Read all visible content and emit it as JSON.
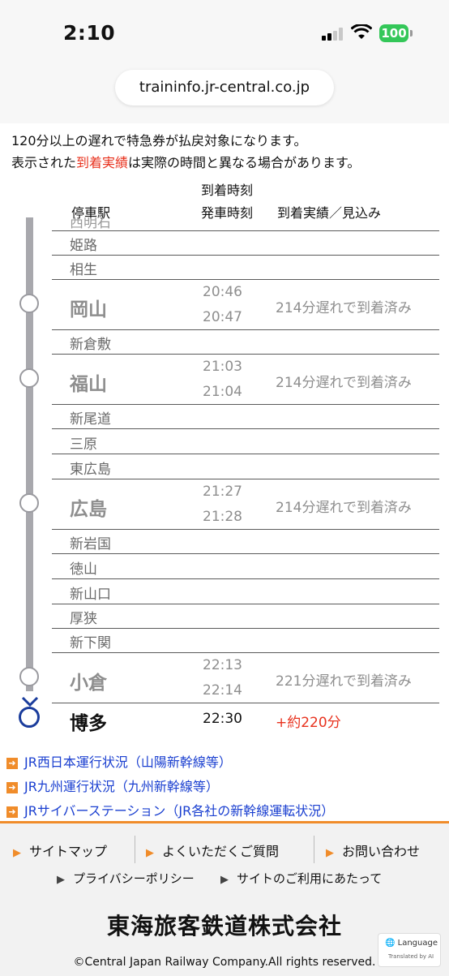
{
  "status_bar": {
    "time": "2:10",
    "battery": "100"
  },
  "url": "traininfo.jr-central.co.jp",
  "notice": {
    "line1": "120分以上の遅れで特急券が払戻対象になります。",
    "line2_pre": "表示された",
    "line2_highlight": "到着実績",
    "line2_post": "は実際の時間と異なる場合があります。"
  },
  "table_header": {
    "station": "停車駅",
    "arrival": "到着時刻",
    "departure": "発車時刻",
    "actual": "到着実績／見込み"
  },
  "stations": [
    {
      "name": "西明石"
    },
    {
      "name": "姫路"
    },
    {
      "name": "相生"
    },
    {
      "name": "岡山",
      "arr": "20:46",
      "dep": "20:47",
      "status": "214分遅れで到着済み"
    },
    {
      "name": "新倉敷"
    },
    {
      "name": "福山",
      "arr": "21:03",
      "dep": "21:04",
      "status": "214分遅れで到着済み"
    },
    {
      "name": "新尾道"
    },
    {
      "name": "三原"
    },
    {
      "name": "東広島"
    },
    {
      "name": "広島",
      "arr": "21:27",
      "dep": "21:28",
      "status": "214分遅れで到着済み"
    },
    {
      "name": "新岩国"
    },
    {
      "name": "徳山"
    },
    {
      "name": "新山口"
    },
    {
      "name": "厚狭"
    },
    {
      "name": "新下関"
    },
    {
      "name": "小倉",
      "arr": "22:13",
      "dep": "22:14",
      "status": "221分遅れで到着済み"
    },
    {
      "name": "博多",
      "arr": "22:30",
      "status": "+約220分"
    }
  ],
  "links": [
    "JR西日本運行状況（山陽新幹線等）",
    "JR九州運行状況（九州新幹線等）",
    "JRサイバーステーション（JR各社の新幹線運転状況）"
  ],
  "footer": {
    "nav": [
      "サイトマップ",
      "よくいただくご質問",
      "お問い合わせ"
    ],
    "nav2": [
      "プライバシーポリシー",
      "サイトのご利用にあたって"
    ],
    "company": "東海旅客鉄道株式会社",
    "copyright": "©Central Japan Railway Company.All rights reserved.",
    "language": "Language",
    "translated": "Translated by AI"
  },
  "colors": {
    "accent": "#f08c2a",
    "alert": "#e8321e",
    "link": "#1a3fd0",
    "final_node": "#1a3c9c"
  },
  "icons": [
    "signal-icon",
    "wifi-icon",
    "battery-icon",
    "globe-icon",
    "arrow-icon",
    "triangle-icon"
  ]
}
